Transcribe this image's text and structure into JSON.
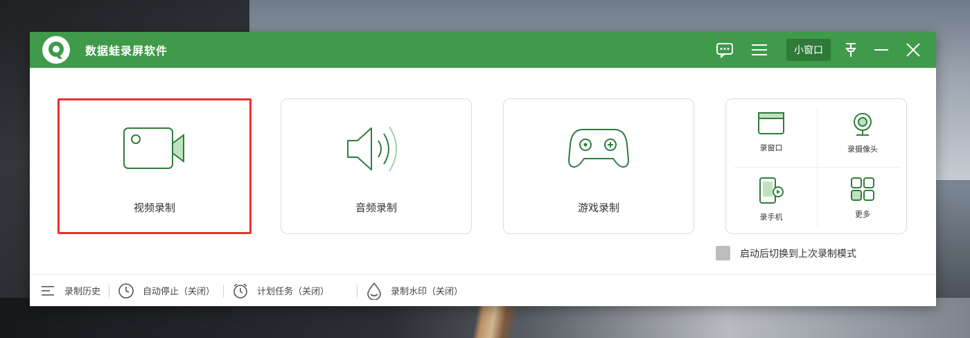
{
  "app": {
    "title": "数据蛙录屏软件"
  },
  "titlebar": {
    "mini_window_label": "小窗口",
    "icons": [
      "feedback-icon",
      "menu-icon",
      "pin-icon",
      "minimize-icon",
      "close-icon"
    ]
  },
  "modes": [
    {
      "label": "视频录制",
      "icon": "video-camera-icon",
      "selected": true
    },
    {
      "label": "音频录制",
      "icon": "speaker-icon",
      "selected": false
    },
    {
      "label": "游戏录制",
      "icon": "gamepad-icon",
      "selected": false
    }
  ],
  "more_modes": [
    {
      "label": "录窗口",
      "icon": "window-icon"
    },
    {
      "label": "录摄像头",
      "icon": "webcam-icon"
    },
    {
      "label": "录手机",
      "icon": "phone-icon"
    },
    {
      "label": "更多",
      "icon": "grid-icon"
    }
  ],
  "option": {
    "restore_last_mode_label": "启动后切换到上次录制模式",
    "checked": false
  },
  "footer": [
    {
      "label": "录制历史",
      "icon": "list-icon"
    },
    {
      "label": "自动停止（关闭）",
      "icon": "clock-icon"
    },
    {
      "label": "计划任务（关闭）",
      "icon": "alarm-icon"
    },
    {
      "label": "录制水印（关闭）",
      "icon": "watermark-icon"
    }
  ],
  "colors": {
    "titlebar": "#3f9a4a",
    "accent": "#2e7d3a",
    "selection_border": "#e5312b"
  }
}
